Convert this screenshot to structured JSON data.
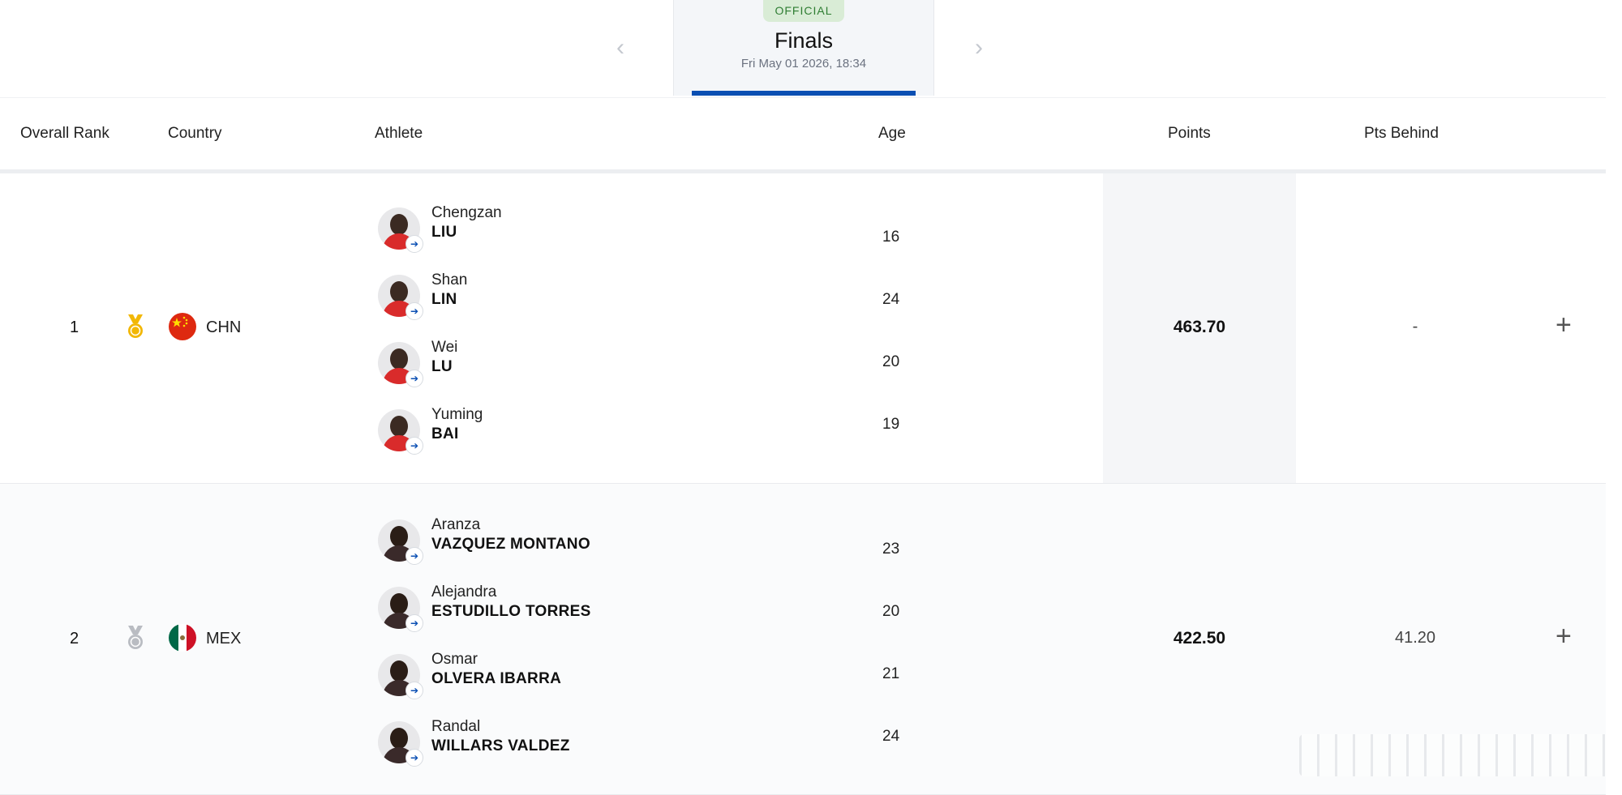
{
  "stage": {
    "badge": "OFFICIAL",
    "title": "Finals",
    "date": "Fri May 01 2026, 18:34",
    "prev_glyph": "‹",
    "next_glyph": "›"
  },
  "table": {
    "columns": [
      "Overall Rank",
      "Country",
      "Athlete",
      "Age",
      "Points",
      "Pts Behind"
    ],
    "rows": [
      {
        "rank": "1",
        "medal": "gold-medal-icon",
        "country": "CHN",
        "points": "463.70",
        "pts_behind": "-",
        "athletes": [
          {
            "first": "Chengzan",
            "last": "LIU",
            "age": "16"
          },
          {
            "first": "Shan",
            "last": "LIN",
            "age": "24"
          },
          {
            "first": "Wei",
            "last": "LU",
            "age": "20"
          },
          {
            "first": "Yuming",
            "last": "BAI",
            "age": "19"
          }
        ]
      },
      {
        "rank": "2",
        "medal": "silver-medal-icon",
        "country": "MEX",
        "points": "422.50",
        "pts_behind": "41.20",
        "athletes": [
          {
            "first": "Aranza",
            "last": "VAZQUEZ MONTANO",
            "age": "23"
          },
          {
            "first": "Alejandra",
            "last": "ESTUDILLO TORRES",
            "age": "20"
          },
          {
            "first": "Osmar",
            "last": "OLVERA IBARRA",
            "age": "21"
          },
          {
            "first": "Randal",
            "last": "WILLARS VALDEZ",
            "age": "24"
          }
        ]
      }
    ]
  },
  "expand_glyph": "+",
  "colors": {
    "accent": "#0b4fb3",
    "badge_bg": "#d9ecd6",
    "badge_text": "#2e7d32",
    "gold": "#f2b705",
    "silver": "#b9bcc2"
  }
}
